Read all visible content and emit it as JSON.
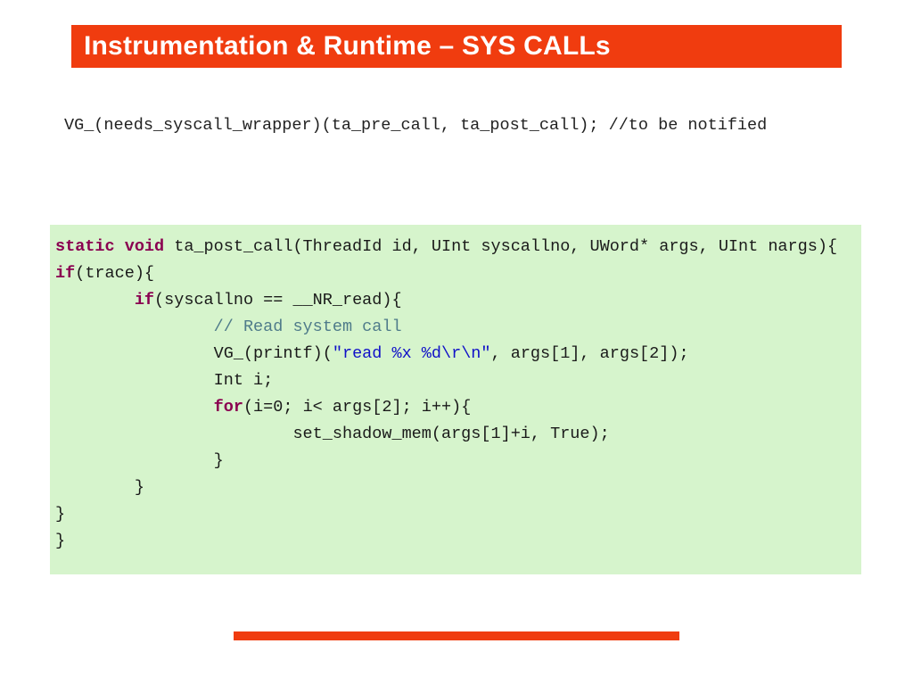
{
  "title": "Instrumentation & Runtime – SYS CALLs",
  "register_line": "VG_(needs_syscall_wrapper)(ta_pre_call, ta_post_call); //to be notified",
  "code": {
    "l1_kw": "static void",
    "l1_sig": " ta_post_call(ThreadId id, UInt syscallno, UWord* args, UInt nargs){",
    "l2_kw": "if",
    "l2_rest": "(trace){",
    "l3_kw": "if",
    "l3_rest": "(syscallno == __NR_read){",
    "l4_comment": "// Read system call",
    "l5a": "VG_(printf)(",
    "l5_str": "\"read %x %d\\r\\n\"",
    "l5b": ", args[1], args[2]);",
    "l6": "Int i;",
    "l7_kw": "for",
    "l7_rest": "(i=0; i< args[2]; i++){",
    "l8": "set_shadow_mem(args[1]+i, True);",
    "l9": "}",
    "l10": "}",
    "l11": "}",
    "l12": "}"
  }
}
